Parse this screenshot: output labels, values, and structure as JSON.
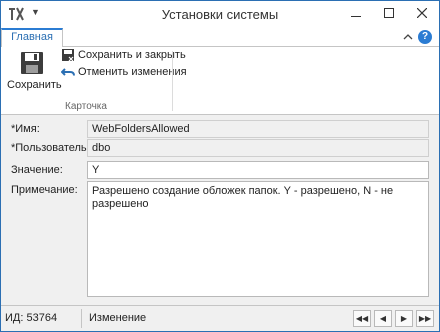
{
  "window": {
    "title": "Установки системы"
  },
  "ribbon": {
    "tab_main": "Главная",
    "save_label": "Сохранить",
    "save_close_label": "Сохранить и закрыть",
    "cancel_changes_label": "Отменить изменения",
    "group_label": "Карточка"
  },
  "form": {
    "name_label": "*Имя:",
    "name_value": "WebFoldersAllowed",
    "user_label": "*Пользователь:",
    "user_value": "dbo",
    "value_label": "Значение:",
    "value_value": "Y",
    "note_label": "Примечание:",
    "note_value": "Разрешено создание обложек папок. Y - разрешено, N - не разрешено"
  },
  "status": {
    "id_text": "ИД: 53764",
    "mode_text": "Изменение"
  },
  "icons": {
    "app": "tools-icon",
    "save": "floppy-disk-icon",
    "save_close": "save-close-icon",
    "cancel": "undo-icon",
    "help": "help-icon"
  },
  "colors": {
    "accent": "#2b7cd3",
    "border": "#2b6fb3"
  }
}
